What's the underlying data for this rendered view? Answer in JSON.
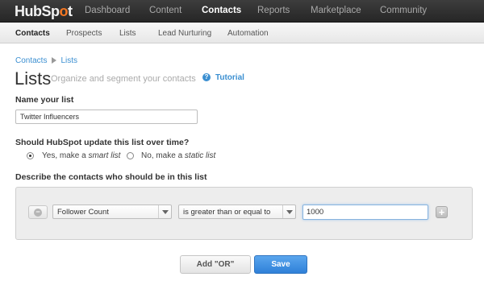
{
  "topnav": {
    "logo_main": "HubSp",
    "logo_accent": "o",
    "logo_end": "t",
    "items": [
      "Dashboard",
      "Content",
      "Contacts",
      "Reports",
      "Marketplace",
      "Community"
    ],
    "active": "Contacts"
  },
  "subnav": {
    "items": [
      "Contacts",
      "Prospects",
      "Lists",
      "Lead Nurturing",
      "Automation"
    ],
    "active": "Contacts"
  },
  "breadcrumb": {
    "parent": "Contacts",
    "current": "Lists"
  },
  "page": {
    "title": "Lists",
    "subtitle": "Organize and segment your contacts",
    "help_icon_glyph": "?",
    "tutorial": "Tutorial"
  },
  "name_section": {
    "label": "Name your list",
    "value": "Twitter Influencers"
  },
  "update_section": {
    "label": "Should HubSpot update this list over time?",
    "option_smart_prefix": "Yes, make a ",
    "option_smart_em": "smart list",
    "option_static_prefix": "No, make a ",
    "option_static_em": "static list",
    "selected": "smart"
  },
  "describe_section": {
    "label": "Describe the contacts who should be in this list",
    "property": "Follower Count",
    "operator": "is greater than or equal to",
    "value": "1000"
  },
  "buttons": {
    "add_or": "Add \"OR\"",
    "save": "Save"
  },
  "colors": {
    "topnav_bg": "#2e2e2e",
    "link": "#3b8fd1",
    "save_button": "#3a8ae0",
    "logo_accent": "#f57722"
  }
}
